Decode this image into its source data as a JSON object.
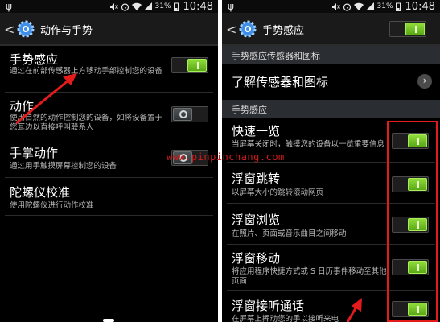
{
  "status": {
    "battery_pct": "31%",
    "time": "10:48"
  },
  "left": {
    "title": "动作与手势",
    "items": [
      {
        "title": "手势感应",
        "subtitle": "通过在前部传感器上方移动手部控制您的设备",
        "state": "on"
      },
      {
        "title": "动作",
        "subtitle": "使用自然的动作控制您的设备，如将设备置于您耳边以直接呼叫联系人",
        "state": "off"
      },
      {
        "title": "手掌动作",
        "subtitle": "通过用手触摸屏幕控制您的设备",
        "state": "off"
      },
      {
        "title": "陀螺仪校准",
        "subtitle": "使用陀螺仪进行动作校准"
      }
    ]
  },
  "right": {
    "title": "手势感应",
    "master_state": "on",
    "section1": "手势感应传感器和图标",
    "learn_item": "了解传感器和图标",
    "section2": "手势感应",
    "items": [
      {
        "title": "快速一览",
        "subtitle": "当屏幕关闭时，触摸您的设备以一览重要信息",
        "state": "on"
      },
      {
        "title": "浮窗跳转",
        "subtitle": "以屏幕大小的跳转滚动网页",
        "state": "on"
      },
      {
        "title": "浮窗浏览",
        "subtitle": "在照片、页面或音乐曲目之间移动",
        "state": "on"
      },
      {
        "title": "浮窗移动",
        "subtitle": "将应用程序快捷方式或 S 日历事件移动至其他页面",
        "state": "on"
      },
      {
        "title": "浮窗接听通话",
        "subtitle": "在屏幕上挥动您的手以接听来电",
        "state": "on"
      }
    ]
  },
  "watermark": "www.pinpinchang.com",
  "colors": {
    "accent": "#3a7bd5",
    "annotation": "#e31b1b",
    "switch_on": "#7cc928"
  }
}
